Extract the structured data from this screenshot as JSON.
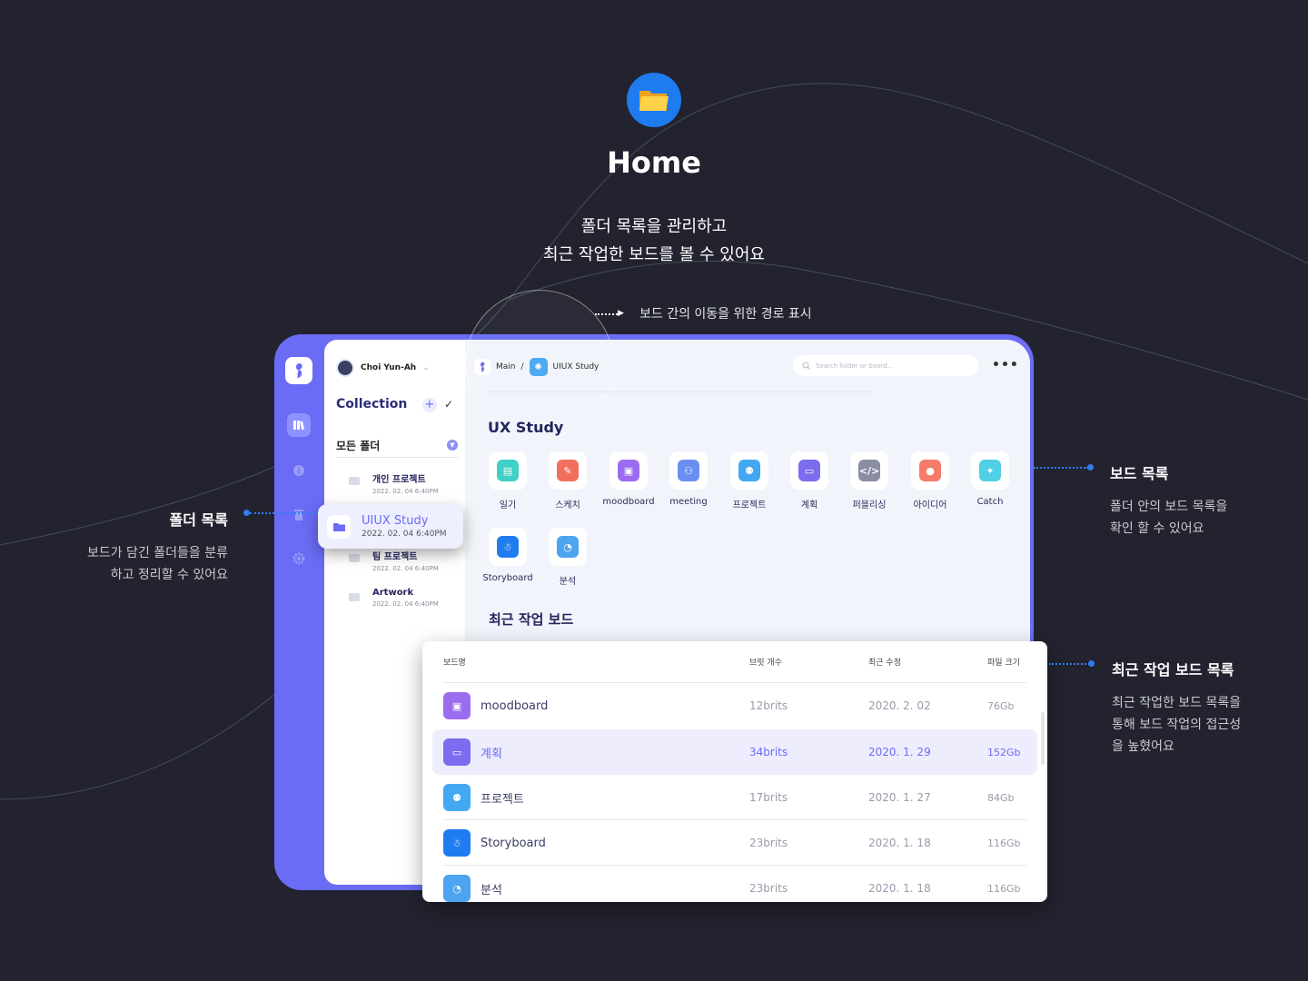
{
  "hero": {
    "title": "Home",
    "subtitle_line1": "폴더 목록을 관리하고",
    "subtitle_line2": "최근 작업한 보드를 볼 수 있어요",
    "icon": "folder-icon"
  },
  "annotations": {
    "breadcrumb_note": "보드 간의 이동을 위한 경로 표시",
    "folder_list": {
      "title": "폴더 목록",
      "desc_line1": "보드가 담긴 폴더들을 분류",
      "desc_line2": "하고 정리할 수 있어요"
    },
    "board_list": {
      "title": "보드 목록",
      "desc_line1": "폴더 안의 보드 목록을",
      "desc_line2": "확인 할 수 있어요"
    },
    "recent_list": {
      "title": "최근 작업 보드 목록",
      "desc_line1": "최근 작업한 보드 목록을",
      "desc_line2": "통해 보드 작업의 접근성",
      "desc_line3": "을 높혔어요"
    }
  },
  "app": {
    "accent": "#6a6cf5",
    "user_name": "Choi Yun-Ah",
    "collection_label": "Collection",
    "add_label": "+",
    "check_label": "✓",
    "all_folders_label": "모든 폴더",
    "folders": [
      {
        "name": "개인 프로젝트",
        "date": "2022. 02. 04 6:40PM"
      },
      {
        "name": "UIUX Study",
        "date": "2022. 02. 04 6:40PM",
        "selected": true
      },
      {
        "name": "팀 프로젝트",
        "date": "2022. 02. 04 6:40PM"
      },
      {
        "name": "Artwork",
        "date": "2022. 02. 04 6:40PM"
      }
    ],
    "breadcrumb": {
      "root": "Main",
      "sep": "/",
      "current": "UIUX Study"
    },
    "search_placeholder": "Search folder or board...",
    "more_label": "•••",
    "study_title": "UX Study",
    "boards": [
      {
        "label": "일기",
        "color": "#3fd1c6",
        "icon": "notebook-icon"
      },
      {
        "label": "스케치",
        "color": "#f26f5e",
        "icon": "pen-icon"
      },
      {
        "label": "moodboard",
        "color": "#9b6cf0",
        "icon": "image-icon"
      },
      {
        "label": "meeting",
        "color": "#6b8ff0",
        "icon": "people-icon"
      },
      {
        "label": "프로젝트",
        "color": "#42a8f2",
        "icon": "team-icon"
      },
      {
        "label": "계획",
        "color": "#7b6cf0",
        "icon": "calendar-icon"
      },
      {
        "label": "퍼블리싱",
        "color": "#8a8ea3",
        "icon": "code-icon"
      },
      {
        "label": "아이디어",
        "color": "#f57b6a",
        "icon": "bulb-icon"
      },
      {
        "label": "Catch",
        "color": "#4fd0e6",
        "icon": "run-icon"
      },
      {
        "label": "Storyboard",
        "color": "#1f7cf0",
        "icon": "robot-icon"
      },
      {
        "label": "분석",
        "color": "#4da4ef",
        "icon": "chart-hand-icon"
      }
    ],
    "recent_title": "최근 작업 보드",
    "table": {
      "headers": [
        "보드명",
        "브릿 개수",
        "최근 수정",
        "파일 크기"
      ],
      "rows": [
        {
          "name": "moodboard",
          "brits": "12brits",
          "date": "2020. 2. 02",
          "size": "76Gb",
          "color": "#9b6cf0"
        },
        {
          "name": "계획",
          "brits": "34brits",
          "date": "2020. 1. 29",
          "size": "152Gb",
          "color": "#7b6cf0",
          "highlight": true
        },
        {
          "name": "프로젝트",
          "brits": "17brits",
          "date": "2020. 1. 27",
          "size": "84Gb",
          "color": "#42a8f2"
        },
        {
          "name": "Storyboard",
          "brits": "23brits",
          "date": "2020. 1. 18",
          "size": "116Gb",
          "color": "#1f7cf0"
        },
        {
          "name": "분석",
          "brits": "23brits",
          "date": "2020. 1. 18",
          "size": "116Gb",
          "color": "#4da4ef"
        }
      ]
    }
  }
}
